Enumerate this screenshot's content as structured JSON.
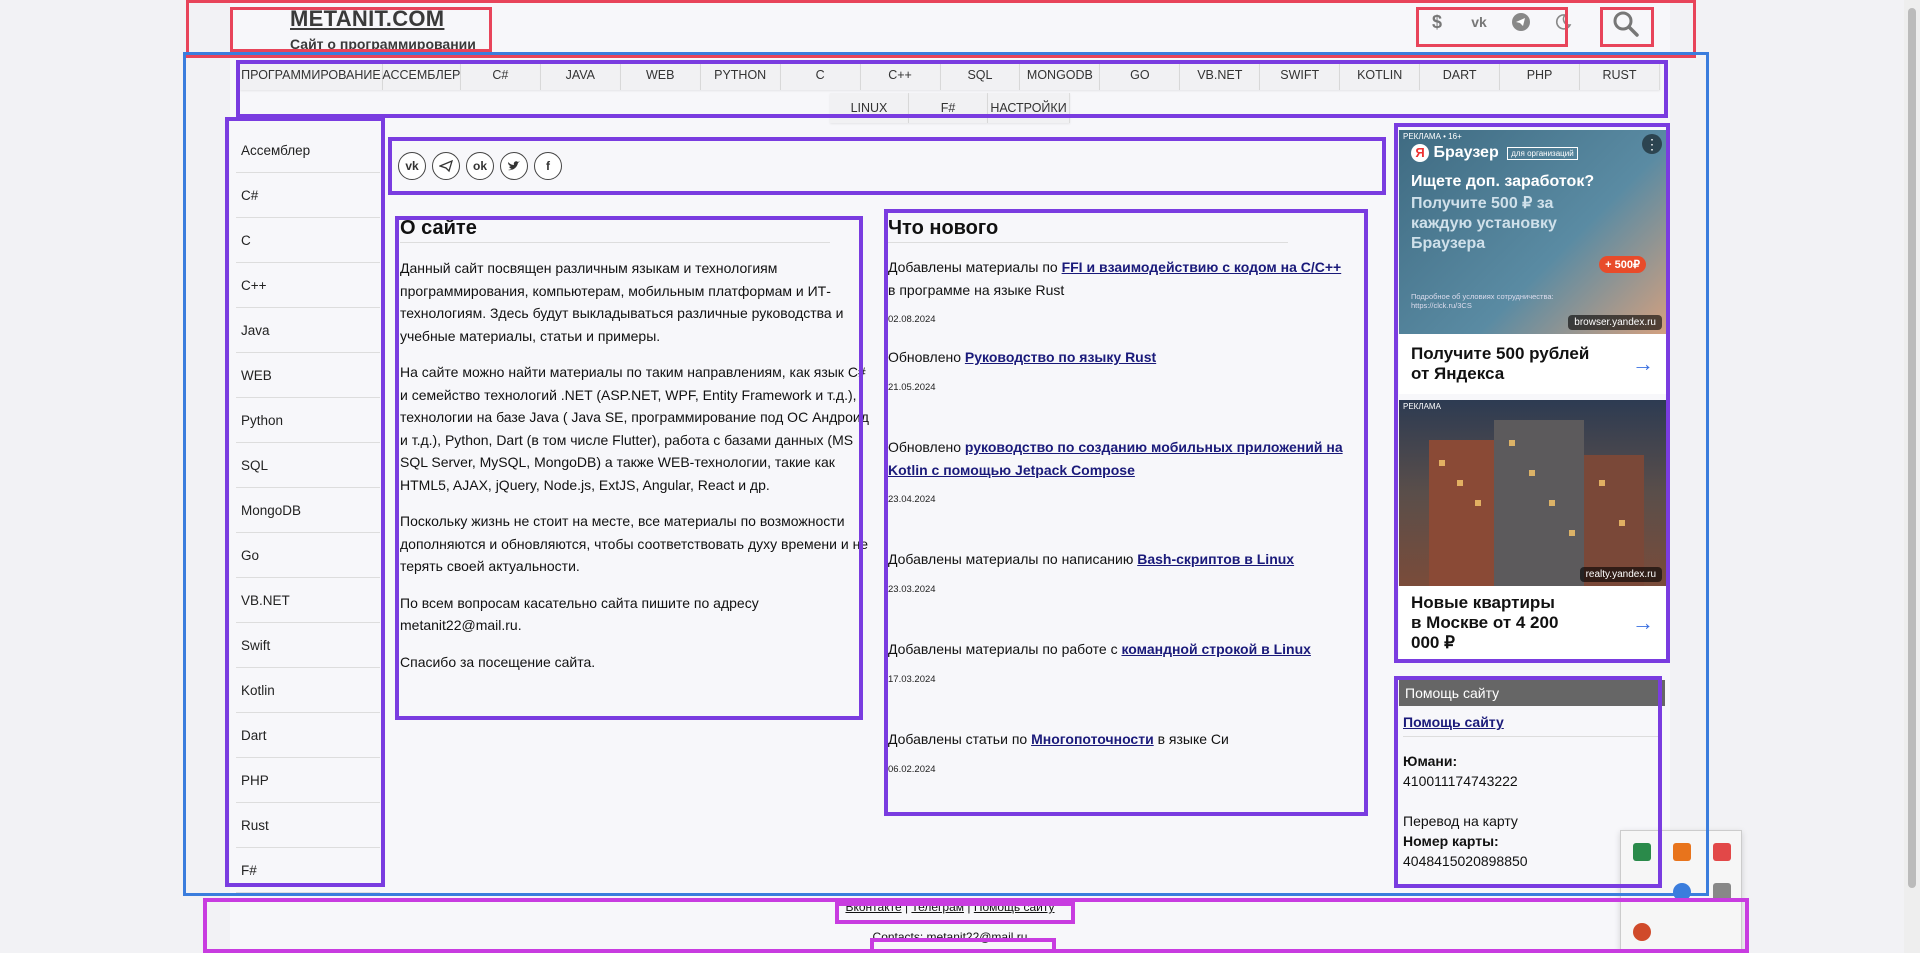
{
  "header": {
    "site_title": "METANIT.COM",
    "site_subtitle": "Сайт о программировании",
    "icons": [
      "dollar-icon",
      "vk-icon",
      "telegram-icon",
      "moon-icon"
    ],
    "search_icon": "search-icon"
  },
  "nav": {
    "row1": [
      "ПРОГРАММИРОВАНИЕ",
      "АССЕМБЛЕР",
      "C#",
      "JAVA",
      "WEB",
      "PYTHON",
      "C",
      "C++",
      "SQL",
      "MONGODB",
      "GO",
      "VB.NET",
      "SWIFT",
      "KOTLIN",
      "DART",
      "PHP",
      "RUST"
    ],
    "row2": [
      "LINUX",
      "F#",
      "НАСТРОЙКИ"
    ]
  },
  "sidebar": {
    "items": [
      "Ассемблер",
      "C#",
      "C",
      "C++",
      "Java",
      "WEB",
      "Python",
      "SQL",
      "MongoDB",
      "Go",
      "VB.NET",
      "Swift",
      "Kotlin",
      "Dart",
      "PHP",
      "Rust",
      "F#"
    ]
  },
  "share": [
    "vk",
    "tg",
    "ok",
    "tw",
    "f"
  ],
  "about": {
    "heading": "О сайте",
    "paragraphs": [
      "Данный сайт посвящен различным языкам и технологиям программирования, компьютерам, мобильным платформам и ИТ-технологиям. Здесь будут выкладываться различные руководства и учебные материалы, статьи и примеры.",
      "На сайте можно найти материалы по таким направлениям, как язык C# и семейство технологий .NET (ASP.NET, WPF, Entity Framework и т.д.), технологии на базе Java ( Java SE, программирование под ОС Андроид и т.д.), Python, Dart (в том числе Flutter), работа с базами данных (MS SQL Server, MySQL, MongoDB) а также WEB-технологии, такие как HTML5, AJAX, jQuery, Node.js, ExtJS, Angular, React и др.",
      "Поскольку жизнь не стоит на месте, все материалы по возможности дополняются и обновляются, чтобы соответствовать духу времени и не терять своей актуальности.",
      "По всем вопросам касательно сайта пишите по адресу metanit22@mail.ru.",
      "Спасибо за посещение сайта."
    ]
  },
  "news": {
    "heading": "Что нового",
    "items": [
      {
        "pre": "Добавлены материалы по ",
        "link": "FFI и взаимодействию с кодом на C/C++",
        "post": " в программе на языке Rust",
        "date": "02.08.2024"
      },
      {
        "pre": "Обновлено ",
        "link": "Руководство по языку Rust",
        "post": "",
        "date": "21.05.2024"
      },
      {
        "pre": "Обновлено ",
        "link": "руководство по созданию мобильных приложений на Kotlin с помощью Jetpack Compose",
        "post": "",
        "date": "23.04.2024"
      },
      {
        "pre": "Добавлены материалы по написанию ",
        "link": "Bash-скриптов в Linux",
        "post": "",
        "date": "23.03.2024"
      },
      {
        "pre": "Добавлены материалы по работе с ",
        "link": "командной строкой в Linux",
        "post": "",
        "date": "17.03.2024"
      },
      {
        "pre": "Добавлены статьи по ",
        "link": "Многопоточности",
        "post": " в языке Си",
        "date": "06.02.2024"
      }
    ]
  },
  "ads": [
    {
      "label": "РЕКЛАМА • 16+",
      "brand": "Браузер",
      "brand_tag": "для организаций",
      "headline": "Ищете доп. заработок?",
      "subline": "Получите 500 ₽ за каждую установку Браузера",
      "badge": "+ 500₽",
      "fine": "Подробное об условиях сотрудничества: https://clck.ru/3CS",
      "source": "browser.yandex.ru",
      "caption": "Получите 500 рублей от Яндекса"
    },
    {
      "label": "РЕКЛАМА",
      "source": "realty.yandex.ru",
      "caption": "Новые квартиры в Москве от 4 200 000 ₽"
    }
  ],
  "help": {
    "title": "Помощь сайту",
    "link": "Помощь сайту",
    "yoomoney_label": "Юмани:",
    "yoomoney_value": "410011174743222",
    "card_transfer": "Перевод на карту",
    "card_label": "Номер карты:",
    "card_value": "4048415020898850"
  },
  "footer": {
    "links": [
      "Вконтакте",
      "Телеграм",
      "Помощь сайту"
    ],
    "contacts": "Contacts: metanit22@mail.ru"
  },
  "colors": {
    "annotation_red": "#e8445a",
    "annotation_blue": "#3b7ddd",
    "annotation_purple": "#7a3ce0",
    "link": "#1a1a7a"
  }
}
